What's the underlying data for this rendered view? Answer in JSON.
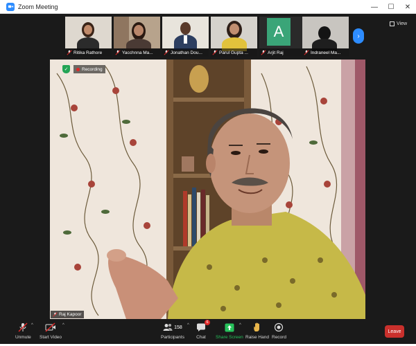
{
  "window": {
    "title": "Zoom Meeting",
    "controls": {
      "minimize": "—",
      "maximize": "☐",
      "close": "✕"
    }
  },
  "participants_strip": {
    "tiles": [
      {
        "name": "Ritika Rathore",
        "muted": true,
        "icon": "muted-mic-icon"
      },
      {
        "name": "Yacchnna Ma...",
        "muted": true,
        "icon": "muted-mic-icon"
      },
      {
        "name": "Jonathan Dou...",
        "muted": true,
        "icon": "muted-mic-icon"
      },
      {
        "name": "Parul Gupta ...",
        "muted": true,
        "icon": "muted-mic-icon"
      },
      {
        "name": "Arjit Raj",
        "muted": true,
        "icon": "muted-mic-icon",
        "initial": "A"
      },
      {
        "name": "Indraneel Ma...",
        "muted": true,
        "icon": "muted-mic-icon"
      }
    ],
    "next_icon": "chevron-right-icon",
    "view_label": "View"
  },
  "stage": {
    "recording_label": "Recording",
    "security_icon": "shield-check-icon",
    "speaker_name": "Raj Kapoor"
  },
  "toolbar": {
    "unmute_label": "Unmute",
    "start_video_label": "Start Video",
    "participants_label": "Participants",
    "participants_count": "158",
    "chat_label": "Chat",
    "chat_badge": "6",
    "share_screen_label": "Share Screen",
    "raise_hand_label": "Raise Hand",
    "record_label": "Record",
    "leave_label": "Leave"
  },
  "colors": {
    "accent": "#2d8cff",
    "share_green": "#27c15b",
    "leave_red": "#c9302c",
    "recording_red": "#e02828",
    "background": "#1a1a1a"
  }
}
